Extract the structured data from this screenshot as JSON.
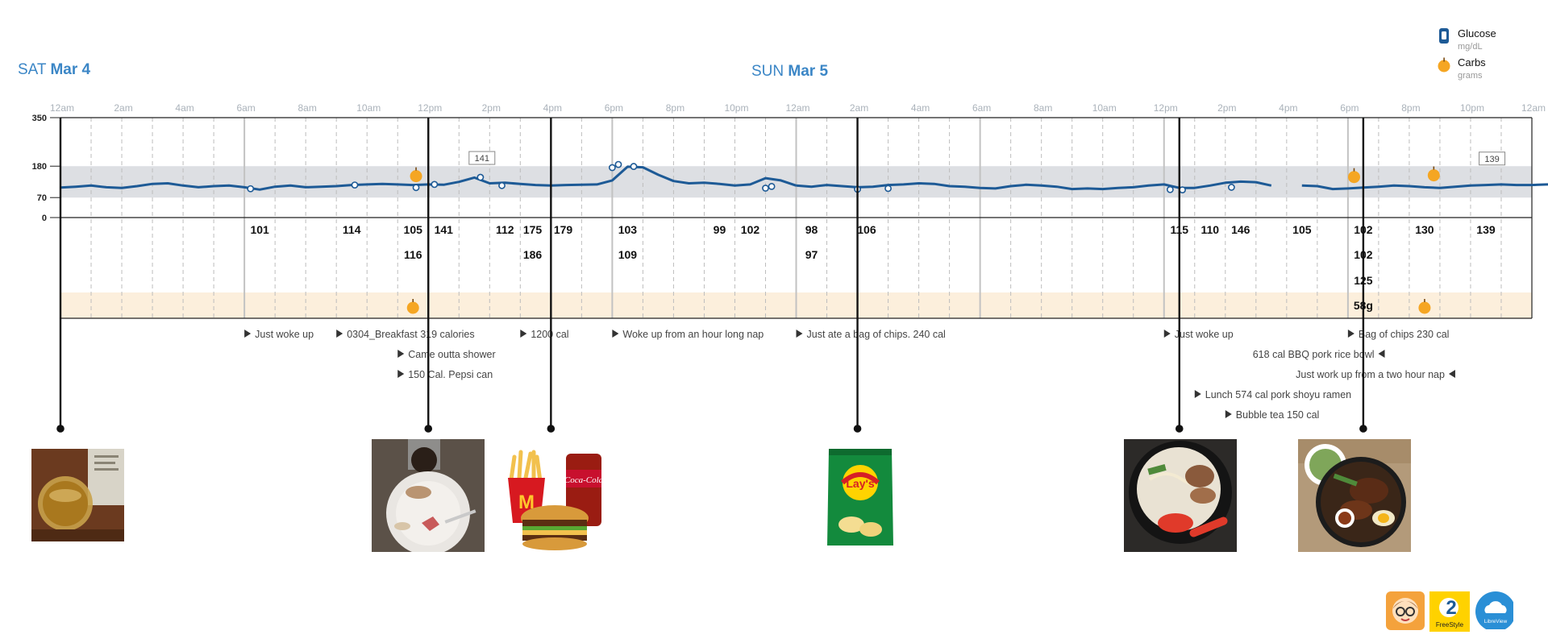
{
  "days": [
    {
      "dow": "SAT",
      "date": "Mar 4"
    },
    {
      "dow": "SUN",
      "date": "Mar 5"
    }
  ],
  "legend": [
    {
      "icon": "glucose-sensor-icon",
      "name": "Glucose",
      "unit": "mg/dL",
      "color": "#1d5a96"
    },
    {
      "icon": "apple-icon",
      "name": "Carbs",
      "unit": "grams",
      "color": "#f5a623"
    }
  ],
  "chart_data": {
    "type": "line",
    "x_unit": "hours since Sat Mar 4 12am",
    "x_range": [
      0,
      48
    ],
    "y_label": "mg/dL",
    "ylim": [
      0,
      350
    ],
    "y_ticks": [
      0,
      70,
      180,
      350
    ],
    "target_range": [
      70,
      180
    ],
    "x_tick_labels": [
      "12am",
      "2am",
      "4am",
      "6am",
      "8am",
      "10am",
      "12pm",
      "2pm",
      "4pm",
      "6pm",
      "8pm",
      "10pm",
      "12am",
      "2am",
      "4am",
      "6am",
      "8am",
      "10am",
      "12pm",
      "2pm",
      "4pm",
      "6pm",
      "8pm",
      "10pm",
      "12am"
    ],
    "series": [
      {
        "name": "Glucose",
        "color": "#1d5a96",
        "segments": [
          [
            [
              0,
              105
            ],
            [
              0.5,
              108
            ],
            [
              1,
              112
            ],
            [
              1.5,
              106
            ],
            [
              2,
              104
            ],
            [
              2.5,
              110
            ],
            [
              3,
              118
            ],
            [
              3.5,
              120
            ],
            [
              4,
              112
            ],
            [
              4.5,
              106
            ],
            [
              5,
              110
            ],
            [
              5.5,
              112
            ],
            [
              6,
              106
            ],
            [
              6.5,
              98
            ],
            [
              7,
              108
            ],
            [
              7.5,
              112
            ],
            [
              8,
              106
            ],
            [
              8.5,
              108
            ],
            [
              9,
              110
            ],
            [
              9.5,
              114
            ],
            [
              10,
              116
            ],
            [
              10.5,
              118
            ],
            [
              11,
              116
            ],
            [
              11.5,
              114
            ],
            [
              12,
              116
            ],
            [
              12.5,
              115
            ],
            [
              13,
              125
            ],
            [
              13.5,
              140
            ],
            [
              14,
              120
            ],
            [
              14.5,
              122
            ],
            [
              15,
              118
            ],
            [
              15.5,
              114
            ],
            [
              16,
              112
            ],
            [
              16.5,
              114
            ],
            [
              17,
              115
            ],
            [
              17.5,
              116
            ],
            [
              18,
              130
            ],
            [
              18.5,
              178
            ],
            [
              19,
              176
            ],
            [
              19.5,
              150
            ],
            [
              20,
              128
            ],
            [
              20.5,
              120
            ],
            [
              21,
              122
            ],
            [
              21.5,
              118
            ],
            [
              22,
              112
            ],
            [
              22.5,
              116
            ],
            [
              23,
              138
            ],
            [
              23.5,
              130
            ],
            [
              24,
              112
            ]
          ],
          [
            [
              24,
              112
            ],
            [
              24.5,
              108
            ],
            [
              25,
              114
            ],
            [
              25.5,
              110
            ],
            [
              26,
              106
            ],
            [
              26.5,
              108
            ],
            [
              27,
              114
            ],
            [
              27.5,
              116
            ],
            [
              28,
              120
            ],
            [
              28.5,
              118
            ],
            [
              29,
              110
            ],
            [
              29.5,
              108
            ],
            [
              30,
              104
            ],
            [
              30.5,
              102
            ],
            [
              31,
              110
            ],
            [
              31.5,
              115
            ],
            [
              32,
              112
            ],
            [
              32.5,
              108
            ],
            [
              33,
              100
            ],
            [
              33.5,
              102
            ],
            [
              34,
              100
            ],
            [
              34.5,
              104
            ],
            [
              35,
              106
            ],
            [
              35.5,
              112
            ],
            [
              36,
              116
            ],
            [
              36.5,
              104
            ],
            [
              37,
              104
            ],
            [
              37.5,
              112
            ],
            [
              38,
              122
            ],
            [
              38.5,
              126
            ],
            [
              39,
              124
            ],
            [
              39.5,
              112
            ]
          ],
          [
            [
              40.5,
              112
            ],
            [
              41,
              110
            ],
            [
              41.5,
              100
            ],
            [
              42,
              102
            ],
            [
              42.5,
              105
            ],
            [
              43,
              108
            ],
            [
              43.5,
              112
            ],
            [
              44,
              110
            ],
            [
              44.5,
              106
            ],
            [
              45,
              104
            ],
            [
              45.5,
              108
            ],
            [
              46,
              112
            ],
            [
              46.5,
              114
            ],
            [
              47,
              116
            ],
            [
              47.5,
              114
            ],
            [
              48,
              114
            ],
            [
              48.5,
              116
            ],
            [
              49,
              118
            ],
            [
              49.5,
              120
            ],
            [
              50,
              118
            ],
            [
              50.5,
              120
            ],
            [
              51,
              124
            ],
            [
              51.5,
              118
            ],
            [
              52,
              114
            ],
            [
              52.5,
              116
            ],
            [
              53,
              115
            ],
            [
              53.5,
              122
            ],
            [
              54,
              136
            ],
            [
              54.5,
              116
            ],
            [
              55,
              112
            ],
            [
              55.5,
              122
            ],
            [
              56,
              146
            ],
            [
              56.5,
              130
            ],
            [
              57,
              112
            ],
            [
              57.5,
              118
            ],
            [
              58,
              108
            ],
            [
              58.5,
              106
            ],
            [
              59,
              108
            ],
            [
              59.5,
              110
            ],
            [
              60,
              106
            ],
            [
              60.5,
              102
            ],
            [
              61,
              104
            ],
            [
              61.5,
              120
            ],
            [
              62,
              122
            ],
            [
              62.5,
              125
            ],
            [
              63,
              118
            ],
            [
              63.5,
              112
            ],
            [
              64,
              110
            ],
            [
              64.5,
              106
            ],
            [
              65,
              108
            ],
            [
              65.5,
              114
            ],
            [
              66,
              132
            ],
            [
              66.5,
              126
            ],
            [
              67,
              128
            ],
            [
              67.5,
              124
            ],
            [
              68,
              120
            ],
            [
              68.5,
              126
            ],
            [
              69,
              139
            ],
            [
              69.5,
              130
            ],
            [
              70,
              118
            ],
            [
              70.5,
              114
            ],
            [
              71,
              125
            ],
            [
              71.5,
              136
            ],
            [
              72,
              116
            ]
          ]
        ]
      }
    ],
    "markers": [
      {
        "x": 6.2,
        "y": 101,
        "label": "101"
      },
      {
        "x": 9.6,
        "y": 114,
        "label": "114"
      },
      {
        "x": 11.6,
        "y": 105,
        "label": "105"
      },
      {
        "x": 12.2,
        "y": 116,
        "label": "116"
      },
      {
        "x": 13.7,
        "y": 141,
        "label": "141"
      },
      {
        "x": 14.4,
        "y": 112,
        "label": "112"
      },
      {
        "x": 18.0,
        "y": 175,
        "label": "175"
      },
      {
        "x": 18.2,
        "y": 186,
        "label": "186"
      },
      {
        "x": 18.7,
        "y": 179,
        "label": "179"
      },
      {
        "x": 23.0,
        "y": 103,
        "label": "103"
      },
      {
        "x": 23.2,
        "y": 109,
        "label": "109"
      },
      {
        "x": 26.0,
        "y": 99,
        "label": "99"
      },
      {
        "x": 27.0,
        "y": 102,
        "label": "102"
      },
      {
        "x": 36.2,
        "y": 98,
        "label": "98"
      },
      {
        "x": 36.6,
        "y": 97,
        "label": "97"
      },
      {
        "x": 38.2,
        "y": 106,
        "label": "106"
      },
      {
        "x": 54.1,
        "y": 115,
        "label": "115"
      },
      {
        "x": 55.1,
        "y": 110,
        "label": "110"
      },
      {
        "x": 56.0,
        "y": 146,
        "label": "146"
      },
      {
        "x": 58.0,
        "y": 105,
        "label": "105"
      },
      {
        "x": 61.0,
        "y": 102,
        "label": "102"
      },
      {
        "x": 61.2,
        "y": 102,
        "label": "102"
      },
      {
        "x": 61.9,
        "y": 125,
        "label": "125"
      },
      {
        "x": 64.4,
        "y": 130,
        "label": "130"
      },
      {
        "x": 66.6,
        "y": 139,
        "label": "139"
      }
    ],
    "value_labels": [
      {
        "x": 6.5,
        "row": 0,
        "text": "101"
      },
      {
        "x": 9.5,
        "row": 0,
        "text": "114"
      },
      {
        "x": 11.5,
        "row": 0,
        "text": "105"
      },
      {
        "x": 11.5,
        "row": 1,
        "text": "116"
      },
      {
        "x": 12.5,
        "row": 0,
        "text": "141"
      },
      {
        "x": 14.5,
        "row": 0,
        "text": "112"
      },
      {
        "x": 15.4,
        "row": 0,
        "text": "175"
      },
      {
        "x": 15.4,
        "row": 1,
        "text": "186"
      },
      {
        "x": 16.4,
        "row": 0,
        "text": "179"
      },
      {
        "x": 18.5,
        "row": 0,
        "text": "103"
      },
      {
        "x": 18.5,
        "row": 1,
        "text": "109"
      },
      {
        "x": 21.5,
        "row": 0,
        "text": "99"
      },
      {
        "x": 22.5,
        "row": 0,
        "text": "102"
      },
      {
        "x": 24.5,
        "row": 0,
        "text": "98"
      },
      {
        "x": 24.5,
        "row": 1,
        "text": "97"
      },
      {
        "x": 26.3,
        "row": 0,
        "text": "106"
      },
      {
        "x": 36.5,
        "row": 0,
        "text": "115"
      },
      {
        "x": 37.5,
        "row": 0,
        "text": "110"
      },
      {
        "x": 38.5,
        "row": 0,
        "text": "146"
      },
      {
        "x": 40.5,
        "row": 0,
        "text": "105"
      },
      {
        "x": 42.5,
        "row": 0,
        "text": "102"
      },
      {
        "x": 42.5,
        "row": 1,
        "text": "102"
      },
      {
        "x": 42.5,
        "row": 2,
        "text": "125"
      },
      {
        "x": 42.5,
        "row": 3,
        "text": "58g"
      },
      {
        "x": 44.5,
        "row": 0,
        "text": "130"
      },
      {
        "x": 46.5,
        "row": 0,
        "text": "139"
      }
    ],
    "callouts": [
      {
        "x": 13.75,
        "y": 141,
        "text": "141"
      },
      {
        "x": 46.7,
        "y": 139,
        "text": "139"
      }
    ],
    "carb_events": [
      {
        "x": 11.6,
        "y": 145
      },
      {
        "x": 42.2,
        "y": 142
      },
      {
        "x": 44.8,
        "y": 148
      }
    ],
    "carb_lane_icons": [
      {
        "x": 11.5
      },
      {
        "x": 44.5
      }
    ],
    "notes": [
      {
        "x": 6.0,
        "row": 0,
        "dir": "right",
        "text": "Just woke up"
      },
      {
        "x": 9.0,
        "row": 0,
        "dir": "right",
        "text": "0304_Breakfast 319 calories"
      },
      {
        "x": 11.0,
        "row": 1,
        "dir": "right",
        "text": "Came outta shower"
      },
      {
        "x": 11.0,
        "row": 2,
        "dir": "right",
        "text": "150 Cal. Pepsi can"
      },
      {
        "x": 15.0,
        "row": 0,
        "dir": "right",
        "text": "1200 cal"
      },
      {
        "x": 18.0,
        "row": 0,
        "dir": "right",
        "text": "Woke up from an hour long nap"
      },
      {
        "x": 24.0,
        "row": 0,
        "dir": "right",
        "text": "Just ate a bag of chips. 240 cal"
      },
      {
        "x": 36.0,
        "row": 0,
        "dir": "right",
        "text": "Just woke up"
      },
      {
        "x": 42.0,
        "row": 0,
        "dir": "right",
        "text": "Bag of chips 230 cal"
      },
      {
        "x": 43.2,
        "row": 1,
        "dir": "left",
        "text": "618 cal BBQ pork rice bowl"
      },
      {
        "x": 45.5,
        "row": 2,
        "dir": "left",
        "text": "Just work up from a two hour nap"
      },
      {
        "x": 37.0,
        "row": 3,
        "dir": "right",
        "text": "Lunch 574 cal pork shoyu ramen"
      },
      {
        "x": 38.0,
        "row": 4,
        "dir": "right",
        "text": "Bubble tea 150 cal"
      }
    ],
    "photo_pins": [
      {
        "x": 0.0,
        "photo": "photo-drink-on-table"
      },
      {
        "x": 12.0,
        "photo": "photo-breakfast-plate"
      },
      {
        "x": 16.0,
        "photo": "photo-mcdonalds-meal"
      },
      {
        "x": 26.0,
        "photo": "photo-lays-chips"
      },
      {
        "x": 36.5,
        "photo": "photo-pork-ramen"
      },
      {
        "x": 42.5,
        "photo": "photo-bbq-pork-bowl"
      }
    ]
  },
  "photos": [
    {
      "name": "photo-drink-on-table"
    },
    {
      "name": "photo-breakfast-plate"
    },
    {
      "name": "photo-mcdonalds-meal",
      "brand": "Coca-Cola"
    },
    {
      "name": "photo-lays-chips",
      "brand": "Lay's"
    },
    {
      "name": "photo-pork-ramen"
    },
    {
      "name": "photo-bbq-pork-bowl"
    }
  ],
  "logos": [
    {
      "name": "avatar-logo"
    },
    {
      "name": "freestyle-libre2-logo",
      "text": "FreeStyle",
      "number": "2"
    },
    {
      "name": "libreview-logo",
      "text": "LibreView"
    }
  ]
}
